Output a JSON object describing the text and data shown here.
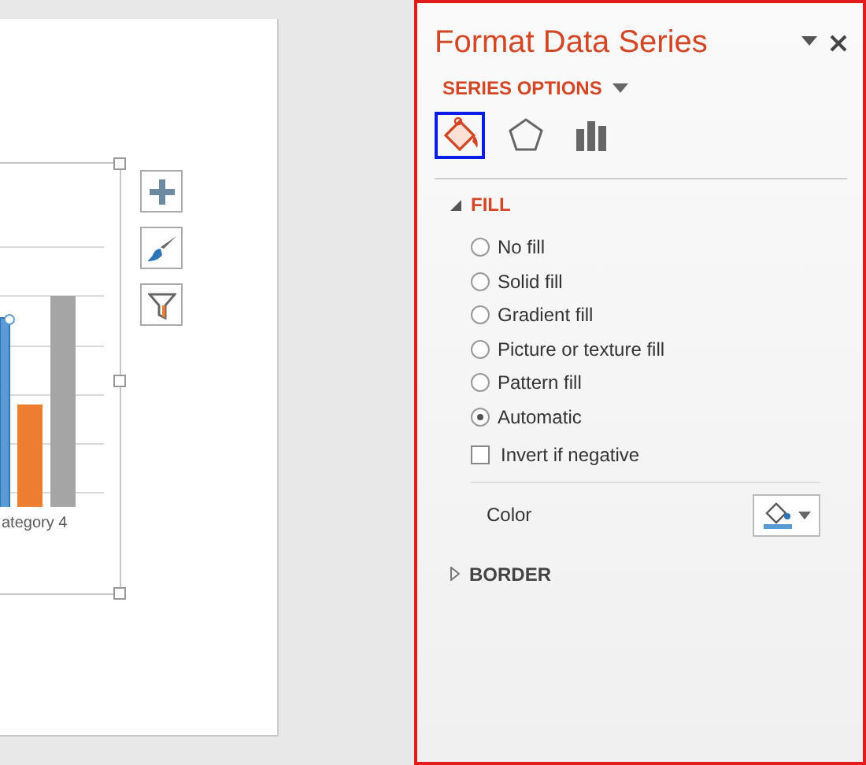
{
  "chart": {
    "category_label": "ategory 4"
  },
  "panel": {
    "title": "Format Data Series",
    "section_menu": "SERIES OPTIONS",
    "icon_tabs": [
      {
        "kind": "fill",
        "selected": true
      },
      {
        "kind": "effects",
        "selected": false
      },
      {
        "kind": "series",
        "selected": false
      }
    ],
    "groups": [
      {
        "title": "FILL",
        "expanded": true,
        "options": [
          {
            "label": "No fill",
            "selected": false
          },
          {
            "label": "Solid fill",
            "selected": false
          },
          {
            "label": "Gradient fill",
            "selected": false
          },
          {
            "label": "Picture or texture fill",
            "selected": false
          },
          {
            "label": "Pattern fill",
            "selected": false
          },
          {
            "label": "Automatic",
            "selected": true
          }
        ],
        "invert": {
          "label": "Invert if negative",
          "checked": false
        },
        "color": {
          "label": "Color"
        }
      },
      {
        "title": "BORDER",
        "expanded": false
      }
    ]
  }
}
